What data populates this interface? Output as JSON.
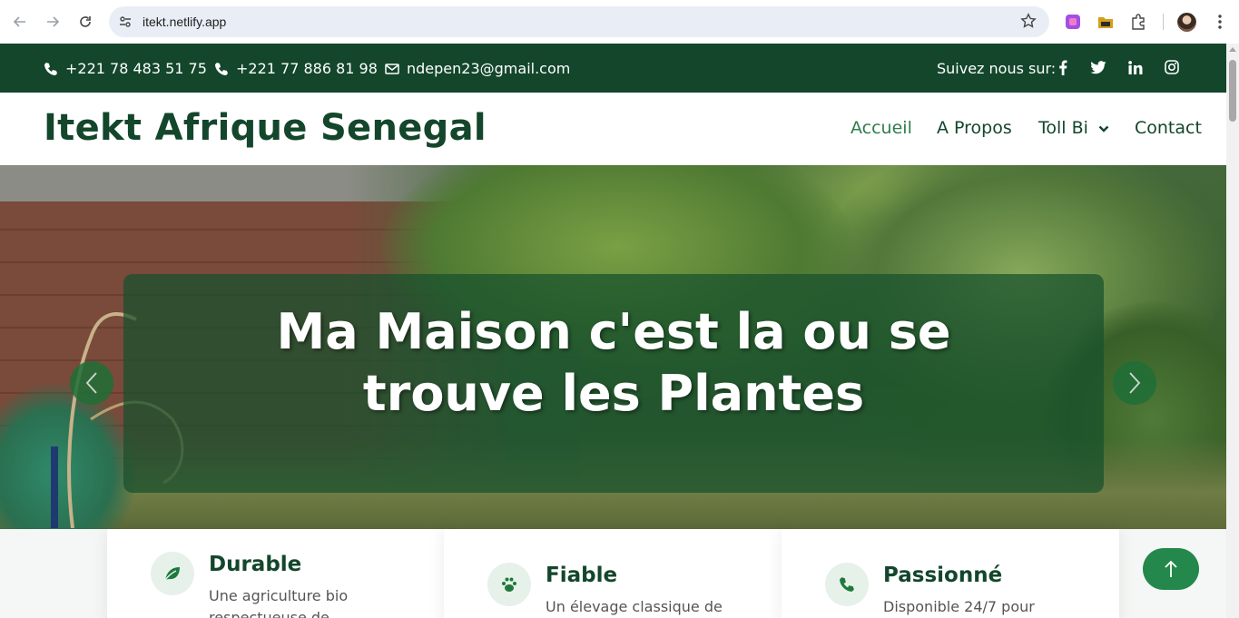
{
  "browser": {
    "url": "itekt.netlify.app"
  },
  "topbar": {
    "phone1": "+221 78 483 51 75",
    "phone2": "+221 77 886 81 98",
    "email": "ndepen23@gmail.com",
    "follow_label": "Suivez nous sur:",
    "socials": [
      "facebook-icon",
      "twitter-icon",
      "linkedin-icon",
      "instagram-icon"
    ]
  },
  "header": {
    "brand": "Itekt Afrique Senegal",
    "menu": [
      {
        "label": "Accueil",
        "active": true
      },
      {
        "label": "A Propos",
        "active": false
      },
      {
        "label": "Toll Bi",
        "active": false,
        "has_dropdown": true
      },
      {
        "label": "Contact",
        "active": false
      }
    ]
  },
  "hero": {
    "title_line1": "Ma Maison c'est la ou se",
    "title_line2": "trouve les Plantes"
  },
  "features": [
    {
      "icon": "leaf-icon",
      "title": "Durable",
      "text_line1": "Une agriculture bio",
      "text_line2": "respectueuse de"
    },
    {
      "icon": "paw-icon",
      "title": "Fiable",
      "text_line1": "Un élevage classique de",
      "text_line2": ""
    },
    {
      "icon": "phone-icon",
      "title": "Passionné",
      "text_line1": "Disponible 24/7 pour",
      "text_line2": ""
    }
  ],
  "colors": {
    "brand_dark": "#13462b",
    "accent": "#2e7d4a",
    "button": "#24874b"
  }
}
